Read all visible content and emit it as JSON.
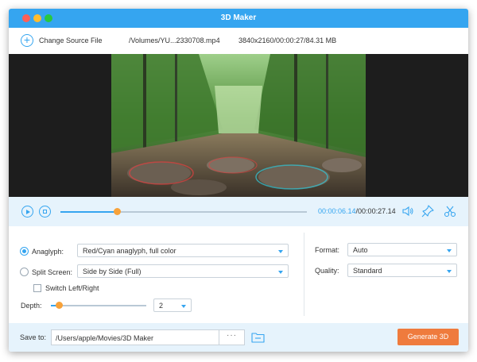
{
  "window": {
    "title": "3D Maker"
  },
  "source": {
    "change_label": "Change Source File",
    "file_path": "/Volumes/YU...2330708.mp4",
    "file_info": "3840x2160/00:00:27/84.31 MB"
  },
  "playback": {
    "current_time": "00:00:06.14",
    "total_time": "/00:00:27.14",
    "progress": 0.23
  },
  "settings": {
    "anaglyph": {
      "label": "Anaglyph:",
      "selected": true,
      "value": "Red/Cyan anaglyph, full color"
    },
    "split_screen": {
      "label": "Split Screen:",
      "selected": false,
      "value": "Side by Side (Full)"
    },
    "switch": {
      "label": "Switch Left/Right",
      "checked": false
    },
    "depth": {
      "label": "Depth:",
      "value": "2",
      "level": 0.08
    },
    "format": {
      "label": "Format:",
      "value": "Auto"
    },
    "quality": {
      "label": "Quality:",
      "value": "Standard"
    }
  },
  "output": {
    "save_label": "Save to:",
    "path": "/Users/apple/Movies/3D Maker",
    "browse_label": "···",
    "generate_label": "Generate 3D"
  },
  "colors": {
    "accent": "#35a5f0",
    "generate": "#ef7b3d",
    "knob": "#f7a23a"
  },
  "icons": [
    "add-icon",
    "play-icon",
    "stop-icon",
    "volume-icon",
    "snapshot-pin-icon",
    "scissors-icon",
    "folder-icon"
  ]
}
